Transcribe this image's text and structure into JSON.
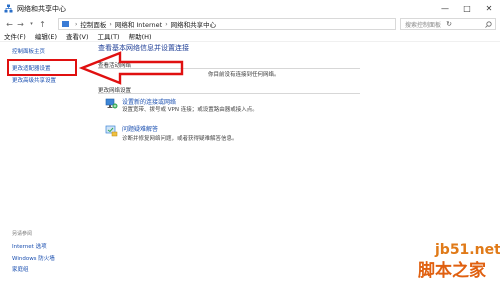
{
  "window": {
    "title": "网络和共享中心",
    "minimize": "—",
    "maximize": "□",
    "close": "✕"
  },
  "address": {
    "crumbs": [
      "控制面板",
      "网络和 Internet",
      "网络和共享中心"
    ],
    "search_placeholder": "搜索控制面板"
  },
  "menu": [
    "文件(F)",
    "编辑(E)",
    "查看(V)",
    "工具(T)",
    "帮助(H)"
  ],
  "sidebar": {
    "items": [
      "控制面板主页",
      "更改适配器设置",
      "更改高级共享设置"
    ],
    "see_also_title": "另请参阅",
    "see_also": [
      "Internet 选项",
      "Windows 防火墙",
      "家庭组"
    ]
  },
  "main": {
    "title": "查看基本网络信息并设置连接",
    "active_networks": "查看活动网络",
    "no_network": "你目前没有连接到任何网络。",
    "change_settings": "更改网络设置",
    "tasks": [
      {
        "icon": "network-setup-icon",
        "link": "设置新的连接或网络",
        "desc": "设置宽带、拨号或 VPN 连接；或设置路由器或接入点。"
      },
      {
        "icon": "troubleshoot-icon",
        "link": "问题疑难解答",
        "desc": "诊断并修复网络问题，或者获得疑难解答信息。"
      }
    ]
  },
  "watermark": {
    "site": "jb51.net",
    "name": "脚本之家"
  },
  "colors": {
    "link": "#1a4fb0",
    "title": "#1e3e96",
    "highlight": "#e01010",
    "watermark": "#e06010"
  }
}
